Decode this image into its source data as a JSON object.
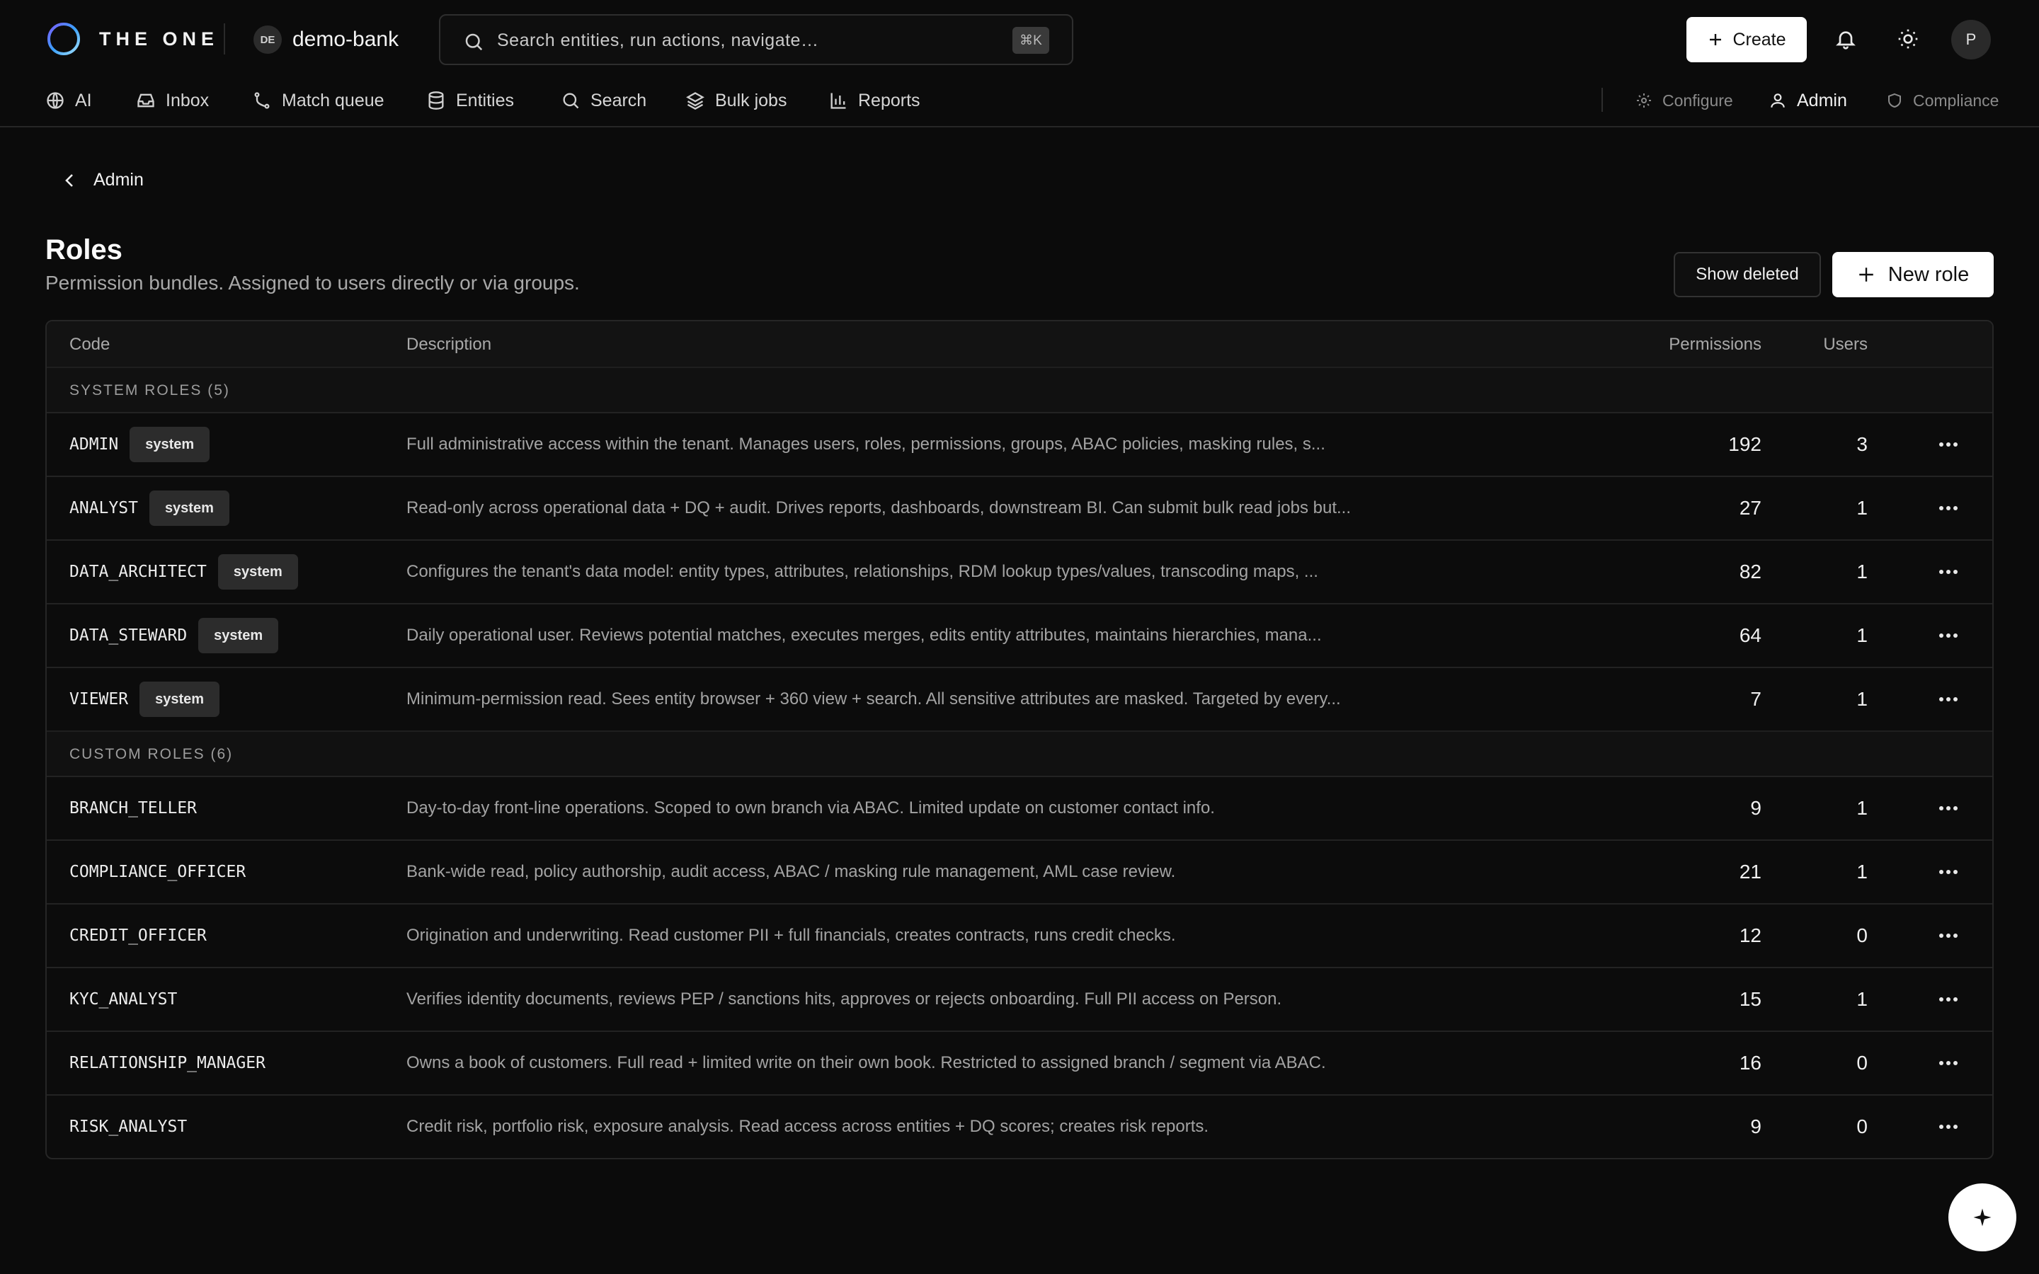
{
  "app": {
    "brand": "THE ONE",
    "tenant_initials": "DE",
    "tenant_name": "demo-bank",
    "search_placeholder": "Search entities, run actions, navigate…",
    "search_shortcut": "⌘K",
    "create_label": "Create",
    "user_initial": "P"
  },
  "nav": {
    "items": [
      {
        "label": "AI",
        "icon": "globe-icon"
      },
      {
        "label": "Inbox",
        "icon": "inbox-icon"
      },
      {
        "label": "Match queue",
        "icon": "merge-icon"
      },
      {
        "label": "Entities",
        "icon": "database-icon"
      },
      {
        "label": "Search",
        "icon": "search-icon"
      },
      {
        "label": "Bulk jobs",
        "icon": "layers-icon"
      },
      {
        "label": "Reports",
        "icon": "bar-chart-icon"
      }
    ],
    "right": [
      {
        "label": "Configure",
        "icon": "gear-icon"
      },
      {
        "label": "Admin",
        "icon": "users-icon"
      },
      {
        "label": "Compliance",
        "icon": "shield-icon"
      }
    ]
  },
  "page": {
    "back_label": "Admin",
    "title": "Roles",
    "subtitle": "Permission bundles. Assigned to users directly or via groups.",
    "show_deleted_label": "Show deleted",
    "new_role_label": "New role"
  },
  "table": {
    "headers": {
      "code": "Code",
      "description": "Description",
      "permissions": "Permissions",
      "users": "Users"
    },
    "system_group_label": "SYSTEM ROLES (5)",
    "custom_group_label": "CUSTOM ROLES (6)",
    "badge_label": "system",
    "system_roles": [
      {
        "code": "ADMIN",
        "description": "Full administrative access within the tenant. Manages users, roles, permissions, groups, ABAC policies, masking rules, s...",
        "permissions": "192",
        "users": "3"
      },
      {
        "code": "ANALYST",
        "description": "Read-only across operational data + DQ + audit. Drives reports, dashboards, downstream BI. Can submit bulk read jobs but...",
        "permissions": "27",
        "users": "1"
      },
      {
        "code": "DATA_ARCHITECT",
        "description": "Configures the tenant's data model: entity types, attributes, relationships, RDM lookup types/values, transcoding maps, ...",
        "permissions": "82",
        "users": "1"
      },
      {
        "code": "DATA_STEWARD",
        "description": "Daily operational user. Reviews potential matches, executes merges, edits entity attributes, maintains hierarchies, mana...",
        "permissions": "64",
        "users": "1"
      },
      {
        "code": "VIEWER",
        "description": "Minimum-permission read. Sees entity browser + 360 view + search. All sensitive attributes are masked. Targeted by every...",
        "permissions": "7",
        "users": "1"
      }
    ],
    "custom_roles": [
      {
        "code": "BRANCH_TELLER",
        "description": "Day-to-day front-line operations. Scoped to own branch via ABAC. Limited update on customer contact info.",
        "permissions": "9",
        "users": "1"
      },
      {
        "code": "COMPLIANCE_OFFICER",
        "description": "Bank-wide read, policy authorship, audit access, ABAC / masking rule management, AML case review.",
        "permissions": "21",
        "users": "1"
      },
      {
        "code": "CREDIT_OFFICER",
        "description": "Origination and underwriting. Read customer PII + full financials, creates contracts, runs credit checks.",
        "permissions": "12",
        "users": "0"
      },
      {
        "code": "KYC_ANALYST",
        "description": "Verifies identity documents, reviews PEP / sanctions hits, approves or rejects onboarding. Full PII access on Person.",
        "permissions": "15",
        "users": "1"
      },
      {
        "code": "RELATIONSHIP_MANAGER",
        "description": "Owns a book of customers. Full read + limited write on their own book. Restricted to assigned branch / segment via ABAC.",
        "permissions": "16",
        "users": "0"
      },
      {
        "code": "RISK_ANALYST",
        "description": "Credit risk, portfolio risk, exposure analysis. Read access across entities + DQ scores; creates risk reports.",
        "permissions": "9",
        "users": "0"
      }
    ]
  },
  "fab_icon": "sparkle-icon"
}
